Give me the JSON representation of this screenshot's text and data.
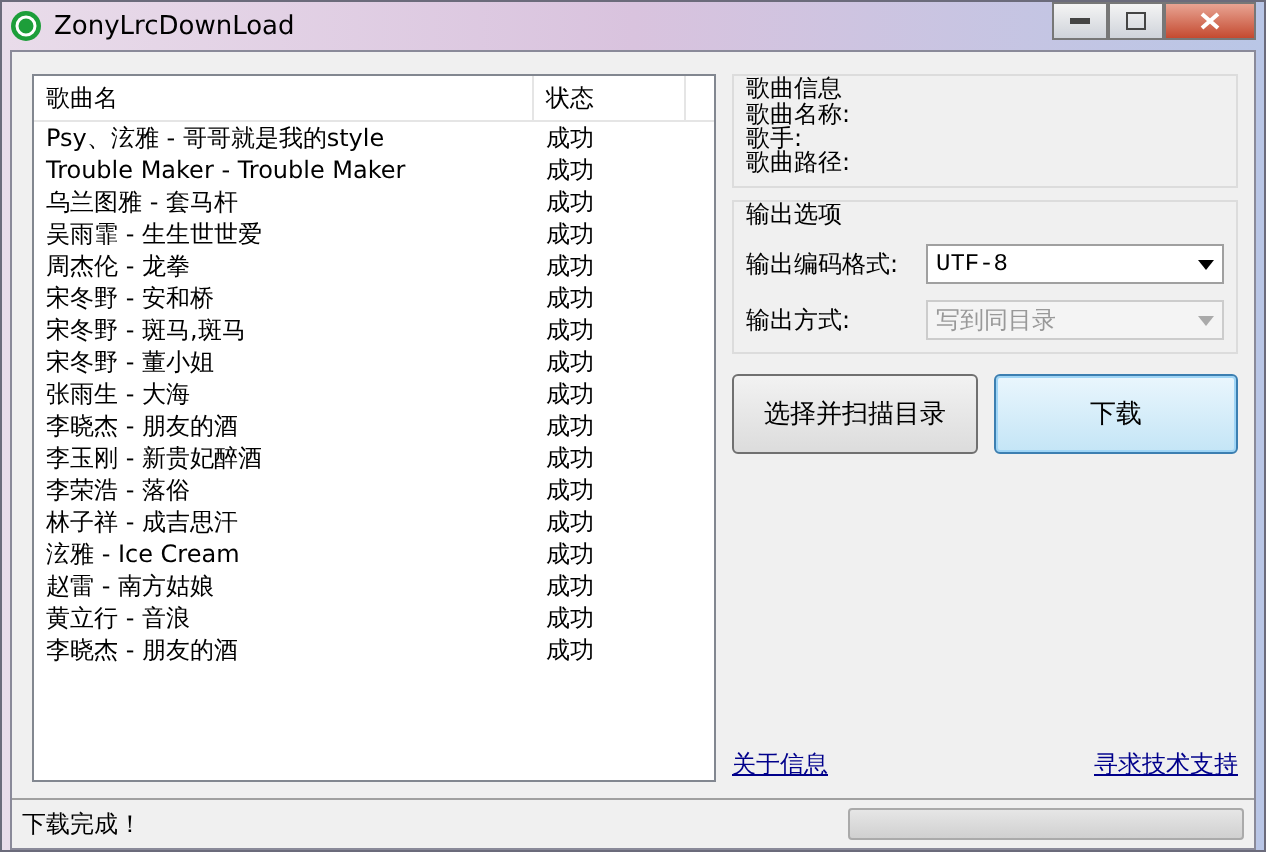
{
  "window": {
    "title": "ZonyLrcDownLoad"
  },
  "song_list": {
    "columns": [
      "歌曲名",
      "状态"
    ],
    "rows": [
      {
        "name": "Psy、泫雅 - 哥哥就是我的style",
        "status": "成功"
      },
      {
        "name": "Trouble Maker - Trouble Maker",
        "status": "成功"
      },
      {
        "name": "乌兰图雅 - 套马杆",
        "status": "成功"
      },
      {
        "name": "吴雨霏 - 生生世世爱",
        "status": "成功"
      },
      {
        "name": "周杰伦 - 龙拳",
        "status": "成功"
      },
      {
        "name": "宋冬野 - 安和桥",
        "status": "成功"
      },
      {
        "name": "宋冬野 - 斑马,斑马",
        "status": "成功"
      },
      {
        "name": "宋冬野 - 董小姐",
        "status": "成功"
      },
      {
        "name": "张雨生 - 大海",
        "status": "成功"
      },
      {
        "name": "李晓杰 - 朋友的酒",
        "status": "成功"
      },
      {
        "name": "李玉刚 - 新贵妃醉酒",
        "status": "成功"
      },
      {
        "name": "李荣浩 - 落俗",
        "status": "成功"
      },
      {
        "name": "林子祥 - 成吉思汗",
        "status": "成功"
      },
      {
        "name": "泫雅 - Ice Cream",
        "status": "成功"
      },
      {
        "name": "赵雷 - 南方姑娘",
        "status": "成功"
      },
      {
        "name": "黄立行 - 音浪",
        "status": "成功"
      },
      {
        "name": "李晓杰 - 朋友的酒",
        "status": "成功"
      }
    ]
  },
  "song_info": {
    "title": "歌曲信息",
    "fields": [
      "歌曲名称:",
      "歌手:",
      "歌曲路径:"
    ]
  },
  "output_options": {
    "title": "输出选项",
    "combos": [
      {
        "label": "输出编码格式:",
        "value": "UTF-8",
        "disabled": false
      },
      {
        "label": "输出方式:",
        "value": "写到同目录",
        "disabled": true
      }
    ]
  },
  "buttons": [
    {
      "label": "选择并扫描目录",
      "focused": false
    },
    {
      "label": "下载",
      "focused": true
    }
  ],
  "links": [
    "关于信息",
    "寻求技术支持"
  ],
  "status_bar": {
    "message": "下载完成！",
    "progress": {
      "level": 0
    }
  }
}
